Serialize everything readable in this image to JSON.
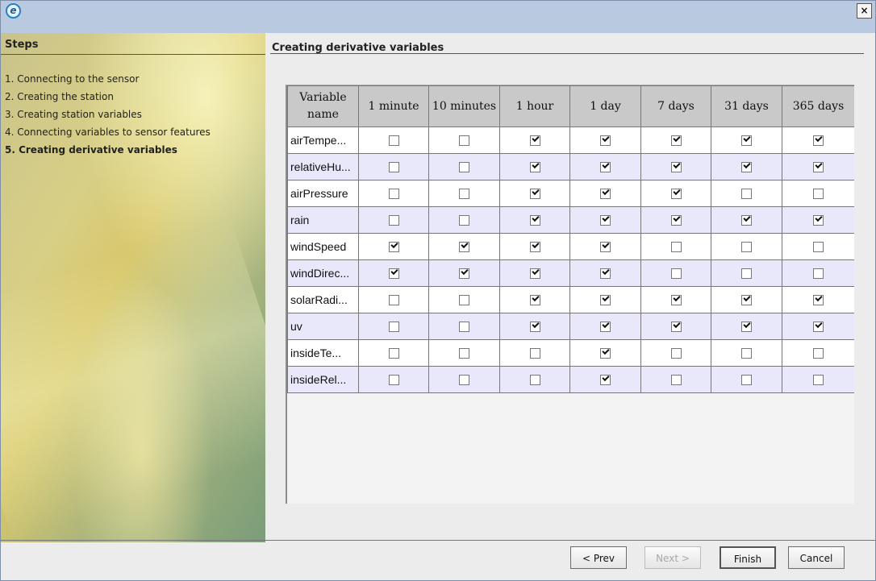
{
  "sidebar": {
    "title": "Steps",
    "steps": [
      "1. Connecting to the sensor",
      "2. Creating the station",
      "3. Creating station variables",
      "4. Connecting variables to sensor features",
      "5. Creating derivative variables"
    ],
    "active_index": 4
  },
  "main": {
    "title": "Creating derivative variables",
    "columns": [
      "Variable name",
      "1 minute",
      "10 minutes",
      "1 hour",
      "1 day",
      "7 days",
      "31 days",
      "365 days"
    ],
    "rows": [
      {
        "name": "airTempe...",
        "checks": [
          false,
          false,
          true,
          true,
          true,
          true,
          true
        ]
      },
      {
        "name": "relativeHu...",
        "checks": [
          false,
          false,
          true,
          true,
          true,
          true,
          true
        ]
      },
      {
        "name": "airPressure",
        "checks": [
          false,
          false,
          true,
          true,
          true,
          false,
          false
        ]
      },
      {
        "name": "rain",
        "checks": [
          false,
          false,
          true,
          true,
          true,
          true,
          true
        ]
      },
      {
        "name": "windSpeed",
        "checks": [
          true,
          true,
          true,
          true,
          false,
          false,
          false
        ]
      },
      {
        "name": "windDirec...",
        "checks": [
          true,
          true,
          true,
          true,
          false,
          false,
          false
        ]
      },
      {
        "name": "solarRadi...",
        "checks": [
          false,
          false,
          true,
          true,
          true,
          true,
          true
        ]
      },
      {
        "name": "uv",
        "checks": [
          false,
          false,
          true,
          true,
          true,
          true,
          true
        ]
      },
      {
        "name": "insideTe...",
        "checks": [
          false,
          false,
          false,
          true,
          false,
          false,
          false
        ]
      },
      {
        "name": "insideRel...",
        "checks": [
          false,
          false,
          false,
          true,
          false,
          false,
          false
        ]
      }
    ]
  },
  "buttons": {
    "prev": "< Prev",
    "next": "Next >",
    "finish": "Finish",
    "cancel": "Cancel"
  },
  "titlebar": {
    "icon": "e-logo-icon",
    "close_label": "×"
  }
}
